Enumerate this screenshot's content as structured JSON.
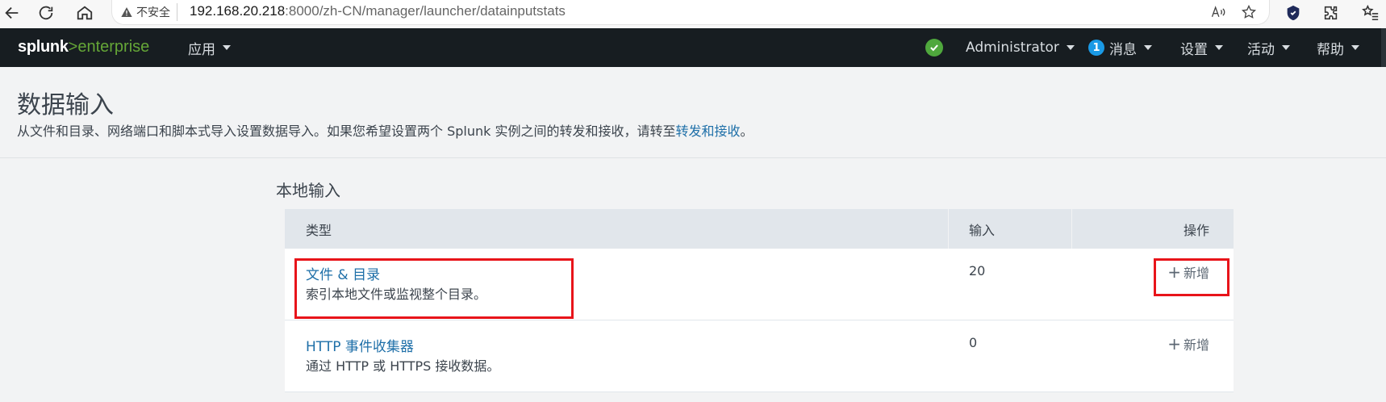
{
  "browser": {
    "security_label": "不安全",
    "url_host": "192.168.20.218",
    "url_rest": ":8000/zh-CN/manager/launcher/datainputstats"
  },
  "splunk_nav": {
    "logo_word": "splunk",
    "logo_suffix": ">enterprise",
    "apps_label": "应用",
    "user_label": "Administrator",
    "messages_count": "1",
    "messages_label": "消息",
    "settings_label": "设置",
    "activity_label": "活动",
    "help_label": "帮助"
  },
  "page": {
    "title": "数据输入",
    "description_prefix": "从文件和目录、网络端口和脚本式导入设置数据导入。如果您希望设置两个 Splunk 实例之间的转发和接收，请转至",
    "description_link": "转发和接收",
    "description_suffix": "。"
  },
  "local_inputs": {
    "section_title": "本地输入",
    "columns": {
      "type": "类型",
      "inputs": "输入",
      "actions": "操作"
    },
    "rows": [
      {
        "title": "文件 & 目录",
        "description": "索引本地文件或监视整个目录。",
        "count": "20",
        "action": "新增"
      },
      {
        "title": "HTTP 事件收集器",
        "description": "通过 HTTP 或 HTTPS 接收数据。",
        "count": "0",
        "action": "新增"
      }
    ]
  },
  "colors": {
    "nav_bg": "#171d21",
    "link": "#1e6fa8",
    "logo_green": "#65a637",
    "highlight": "#e8141a"
  }
}
